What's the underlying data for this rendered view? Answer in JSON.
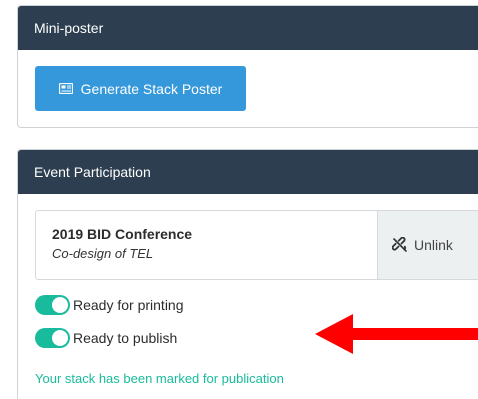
{
  "mini_poster": {
    "header": "Mini-poster",
    "generate_button": "Generate Stack Poster",
    "generate_icon": "newspaper-icon"
  },
  "event_participation": {
    "header": "Event Participation",
    "event": {
      "title": "2019 BID Conference",
      "subtitle": "Co-design of TEL"
    },
    "unlink_button": "Unlink",
    "unlink_icon": "unlink-icon",
    "toggles": [
      {
        "label": "Ready for printing",
        "on": true
      },
      {
        "label": "Ready to publish",
        "on": true
      }
    ],
    "status_message": "Your stack has been marked for publication"
  },
  "colors": {
    "header_bg": "#2c3e50",
    "primary": "#3498db",
    "success": "#18bc9c",
    "annotation_arrow": "#ff0000"
  }
}
